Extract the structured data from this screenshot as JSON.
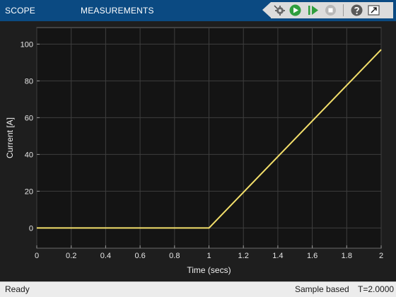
{
  "toolstrip": {
    "tabs": [
      {
        "label": "SCOPE"
      },
      {
        "label": "MEASUREMENTS"
      }
    ],
    "toolbar_icons": [
      "back-arrow-icon",
      "configure-gear-icon",
      "run-icon",
      "step-forward-icon",
      "stop-icon",
      "help-icon",
      "undock-icon"
    ],
    "accent_color": "#0b4a82"
  },
  "status": {
    "state": "Ready",
    "mode": "Sample based",
    "time": "T=2.0000"
  },
  "chart_data": {
    "type": "line",
    "title": "",
    "xlabel": "Time (secs)",
    "ylabel": "Current [A]",
    "xlim": [
      0,
      2
    ],
    "ylim": [
      -11,
      109
    ],
    "xticks": [
      "0",
      "0.2",
      "0.4",
      "0.6",
      "0.8",
      "1",
      "1.2",
      "1.4",
      "1.6",
      "1.8",
      "2"
    ],
    "yticks": [
      "0",
      "20",
      "40",
      "60",
      "80",
      "100"
    ],
    "grid": true,
    "background_color": "#141414",
    "line_color": "#f3df6b",
    "series": [
      {
        "x": [
          0,
          1,
          2
        ],
        "y": [
          0,
          0,
          97
        ]
      }
    ]
  }
}
